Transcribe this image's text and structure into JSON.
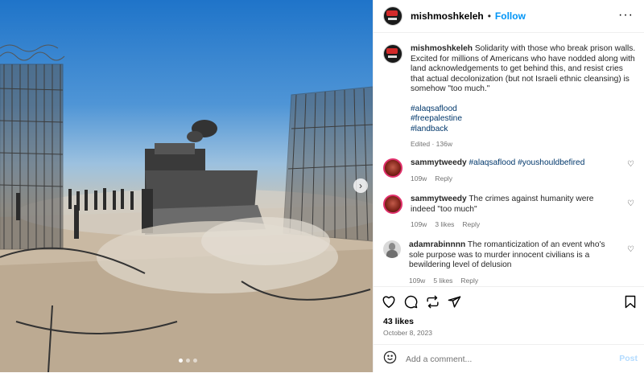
{
  "post": {
    "username": "mishmoshkeleh",
    "follow_label": "Follow",
    "separator": "•",
    "more_label": "···",
    "caption": "Solidarity with those who break prison walls. Excited for millions of Americans who have nodded along with land acknowledgements to get behind this, and resist cries that actual decolonization (but not Israeli ethnic cleansing) is somehow \"too much.\"",
    "hashtags": [
      "#alaqsaflood",
      "#freepalestine",
      "#landback"
    ],
    "edited": "Edited · 136w",
    "likes": "43 likes",
    "date": "October 8, 2023"
  },
  "comments": [
    {
      "username": "sammytweedy",
      "tags": "#alaqsaflood #youshouldbefired",
      "text": "",
      "time": "109w",
      "likes": "",
      "reply_label": "Reply"
    },
    {
      "username": "sammytweedy",
      "tags": "",
      "text": "The crimes against humanity were indeed \"too much\"",
      "time": "109w",
      "likes": "3 likes",
      "reply_label": "Reply"
    },
    {
      "username": "adamrabinnnn",
      "tags": "",
      "text": "The romanticization of an event who's sole purpose was to murder innocent civilians is a bewildering level of delusion",
      "time": "109w",
      "likes": "5 likes",
      "reply_label": "Reply"
    }
  ],
  "add_comment": {
    "placeholder": "Add a comment...",
    "post_label": "Post"
  },
  "carousel": {
    "next_label": "›",
    "slide_count": 3,
    "active_slide": 1
  },
  "colors": {
    "accent": "#0095f6",
    "hashtag": "#00376b",
    "muted": "#737373",
    "post_disabled": "#b3dbff"
  }
}
